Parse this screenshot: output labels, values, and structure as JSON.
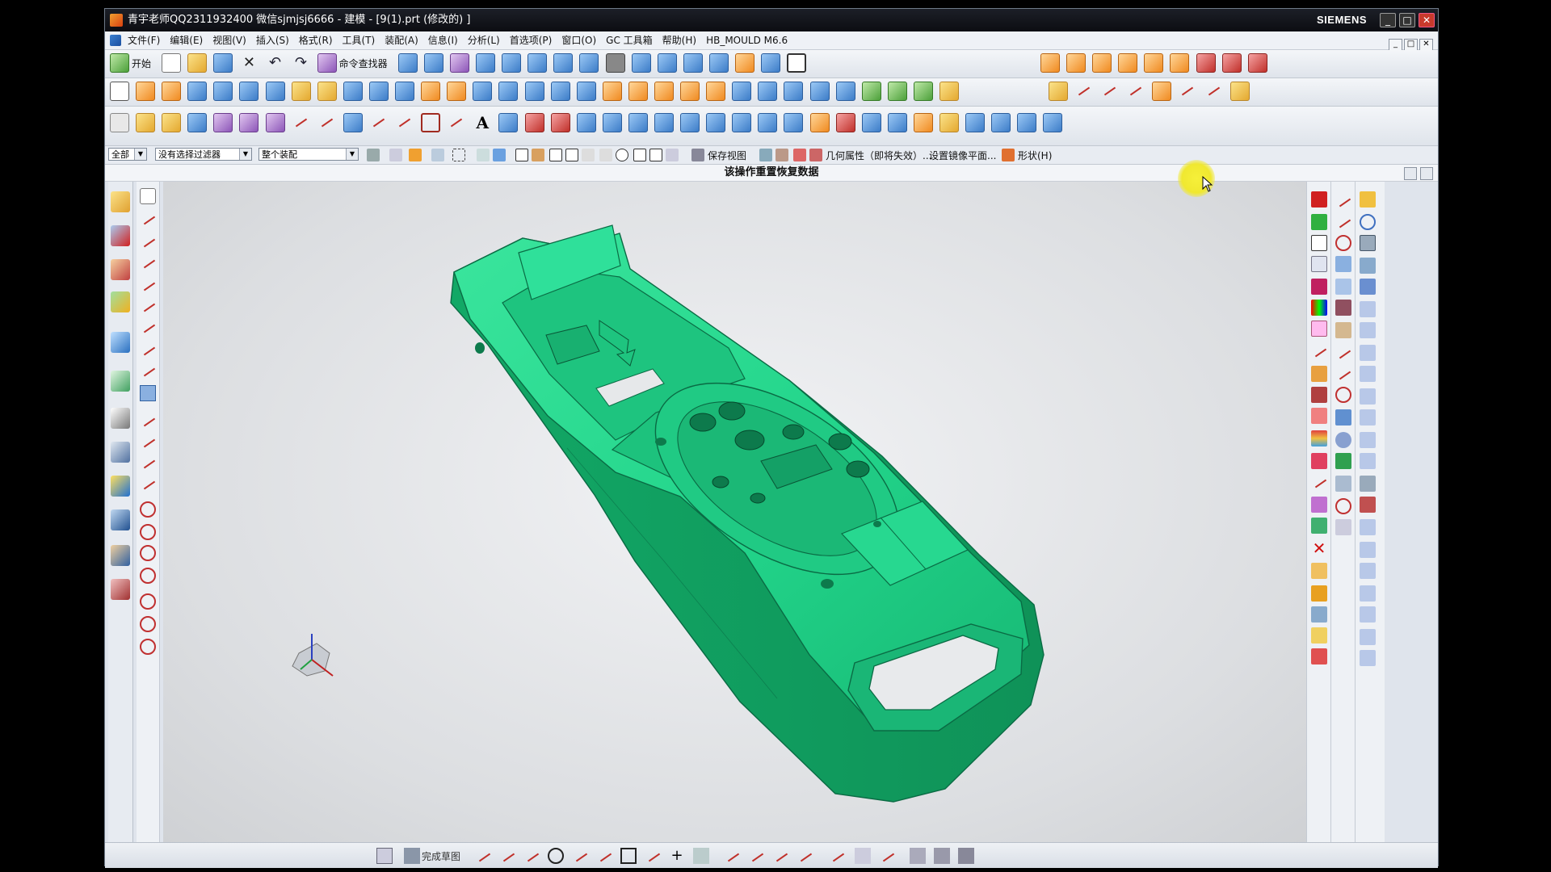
{
  "window": {
    "title": "青宇老师QQ2311932400 微信sjmjsj6666 - 建模 - [9(1).prt  (修改的)  ]",
    "brand": "SIEMENS",
    "min_label": "_",
    "max_label": "□",
    "close_label": "✕"
  },
  "menu": {
    "items": [
      "文件(F)",
      "编辑(E)",
      "视图(V)",
      "插入(S)",
      "格式(R)",
      "工具(T)",
      "装配(A)",
      "信息(I)",
      "分析(L)",
      "首选项(P)",
      "窗口(O)",
      "GC 工具箱",
      "帮助(H)",
      "HB_MOULD M6.6"
    ],
    "mdi": [
      "_",
      "□",
      "✕"
    ]
  },
  "toolbar1": {
    "start_label": "开始",
    "command_finder_label": "命令查找器"
  },
  "selection_bar": {
    "filter_all": "全部",
    "filter_selection": "没有选择过滤器",
    "scope": "整个装配",
    "save_view": "保存视图",
    "geometry_property": "几何属性（即将失效）...",
    "set_mirror_plane": "设置镜像平面...",
    "shape": "形状(H)"
  },
  "cue_line": "该操作重置恢复数据",
  "bottom_bar": {
    "finish_sketch": "完成草图"
  },
  "colors": {
    "model_green": "#22d48a",
    "model_edge": "#0a6b44",
    "titlebar": "#14161d",
    "highlight": "#f0e830"
  }
}
